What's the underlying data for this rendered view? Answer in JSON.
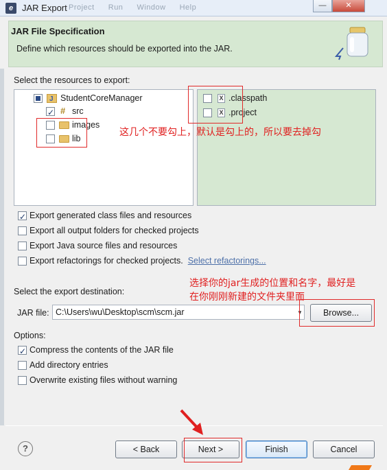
{
  "window": {
    "title": "JAR Export",
    "ghost_menu": [
      "Project",
      "Run",
      "Window",
      "Help"
    ],
    "minimize_glyph": "—",
    "close_glyph": "✕"
  },
  "header": {
    "title": "JAR File Specification",
    "description": "Define which resources should be exported into the JAR."
  },
  "resources": {
    "label": "Select the resources to export:",
    "tree": {
      "project": "StudentCoreManager",
      "children": [
        {
          "label": "src",
          "checked": true
        },
        {
          "label": "images",
          "checked": false
        },
        {
          "label": "lib",
          "checked": false
        }
      ]
    },
    "files": [
      {
        "label": ".classpath",
        "checked": false
      },
      {
        "label": ".project",
        "checked": false
      }
    ]
  },
  "export_options": [
    {
      "label": "Export generated class files and resources",
      "checked": true
    },
    {
      "label": "Export all output folders for checked projects",
      "checked": false
    },
    {
      "label": "Export Java source files and resources",
      "checked": false
    },
    {
      "label": "Export refactorings for checked projects.",
      "checked": false
    }
  ],
  "select_refactorings_link": "Select refactorings...",
  "destination": {
    "label": "Select the export destination:",
    "jar_file_label": "JAR file:",
    "jar_file_value": "C:\\Users\\wu\\Desktop\\scm\\scm.jar",
    "browse_label": "Browse..."
  },
  "options": {
    "label": "Options:",
    "items": [
      {
        "label": "Compress the contents of the JAR file",
        "checked": true
      },
      {
        "label": "Add directory entries",
        "checked": false
      },
      {
        "label": "Overwrite existing files without warning",
        "checked": false
      }
    ]
  },
  "buttons": {
    "help": "?",
    "back": "< Back",
    "next": "Next >",
    "finish": "Finish",
    "cancel": "Cancel"
  },
  "annotations": {
    "uncheck_note": "这几个不要勾上，默认是勾上的，所以要去掉勾",
    "destination_note_line1": "选择你的jar生成的位置和名字，最好是",
    "destination_note_line2": "在你刚刚新建的文件夹里面"
  },
  "colors": {
    "banner_bg": "#d6e8d2",
    "annotation_red": "#e02020"
  }
}
